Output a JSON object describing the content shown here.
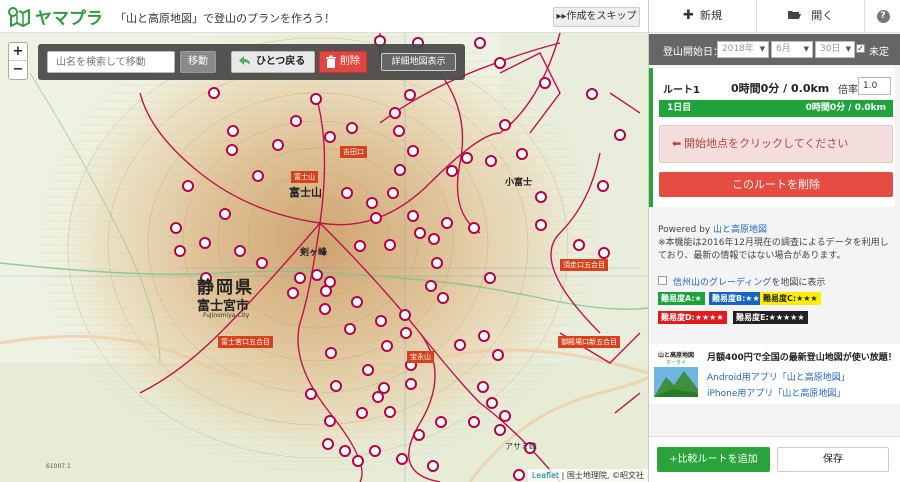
{
  "header": {
    "logo_text": "ヤマプラ",
    "tagline": "「山と高原地図」で登山のプランを作ろう！",
    "skip_label": "作成をスキップ"
  },
  "map": {
    "zoom_in": "+",
    "zoom_out": "−",
    "search_placeholder": "山名を検索して移動",
    "move_label": "移動",
    "undo_label": "ひとつ戻る",
    "delete_label": "削除",
    "detail_map_label": "詳細地図表示",
    "labels": {
      "prefecture": "静岡県",
      "city": "富士宮市",
      "city_en": "Fujinomiya City",
      "peak": "富士山",
      "peak2": "剣ヶ峰",
      "small_fuji": "小富士",
      "hoei": "宝永山",
      "fujinomiya_trail": "富士宮口五合目",
      "gotemba_trail": "御殿場口新五合目",
      "subashiri_trail": "須走口五合目",
      "yoshida_trail": "吉田口",
      "fujisan_tag": "富士山",
      "asami": "アサミ峰",
      "map_code": "61007.1",
      "attribution_leaflet": "Leaflet",
      "attribution_rest": " | 国土地理院, ©昭文社"
    },
    "colors": {
      "marker": "#b5004a",
      "trail": "#c0124d",
      "terrain": "#d9b07a"
    }
  },
  "panel": {
    "tabs": {
      "new": "新規",
      "open": "開く",
      "help": "?"
    },
    "date": {
      "label": "登山開始日：",
      "year": "2018年",
      "month": "6月",
      "day": "30日",
      "undecided": "未定",
      "undecided_checked": true
    },
    "route": {
      "name": "ルート1",
      "total": "0時間0分 / 0.0km",
      "multiplier_label": "倍率",
      "multiplier_value": "1.0",
      "day_label": "1日目",
      "day_total": "0時間0分 / 0.0km",
      "start_hint": "開始地点をクリックしてください",
      "delete_route": "このルートを削除"
    },
    "info": {
      "powered_prefix": "Powered by ",
      "powered_link": "山と高原地図",
      "notice": "※本機能は2016年12月現在の調査によるデータを利用しており、最新の情報ではない場合があります。",
      "grading_link": "信州山のグレーディング",
      "grading_suffix": "を地図に表示",
      "grades": {
        "a": "難易度A:★",
        "b": "難易度B:★★",
        "c": "難易度C:★★★",
        "d": "難易度D:★★★★",
        "e": "難易度E:★★★★★"
      }
    },
    "ad": {
      "icon_text": "山と高原地図",
      "icon_sub": "ホーダイ",
      "title": "月額400円で全国の最新登山地図が使い放題！",
      "android": "Android用アプリ「山と高原地図」",
      "iphone": "iPhone用アプリ「山と高原地図」"
    },
    "bottom": {
      "add_compare": "+比較ルートを追加",
      "save": "保存"
    }
  }
}
